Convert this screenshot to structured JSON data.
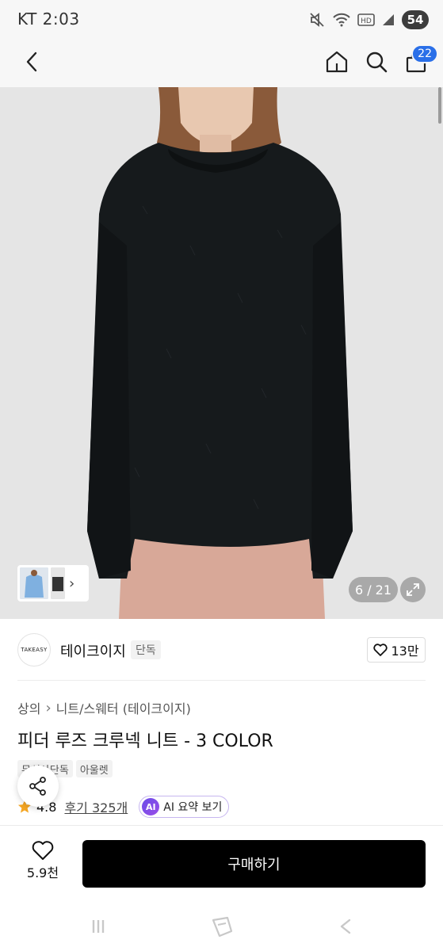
{
  "status_bar": {
    "carrier_time": "KT 2:03",
    "battery": "54"
  },
  "header": {
    "cart_count": "22"
  },
  "gallery": {
    "counter": "6 / 21"
  },
  "brand": {
    "logo_text": "TAKEASY",
    "name": "테이크이지",
    "tag": "단독",
    "likes": "13만"
  },
  "breadcrumb": {
    "category": "상의",
    "subcategory": "니트/스웨터 (테이크이지)"
  },
  "product": {
    "title": "피더 루즈 크루넥 니트 - 3 COLOR",
    "tags": [
      "무신사단독",
      "아울렛"
    ],
    "rating": "4.8",
    "reviews": "후기 325개",
    "ai_summary_badge": "AI",
    "ai_summary_label": "AI 요약 보기"
  },
  "bottom_bar": {
    "wish_count": "5.9천",
    "buy_label": "구매하기"
  },
  "colors": {
    "accent_blue": "#2a6fe8",
    "buy_button": "#000000",
    "star": "#f5a623",
    "ai_purple": "#6a4de8"
  }
}
